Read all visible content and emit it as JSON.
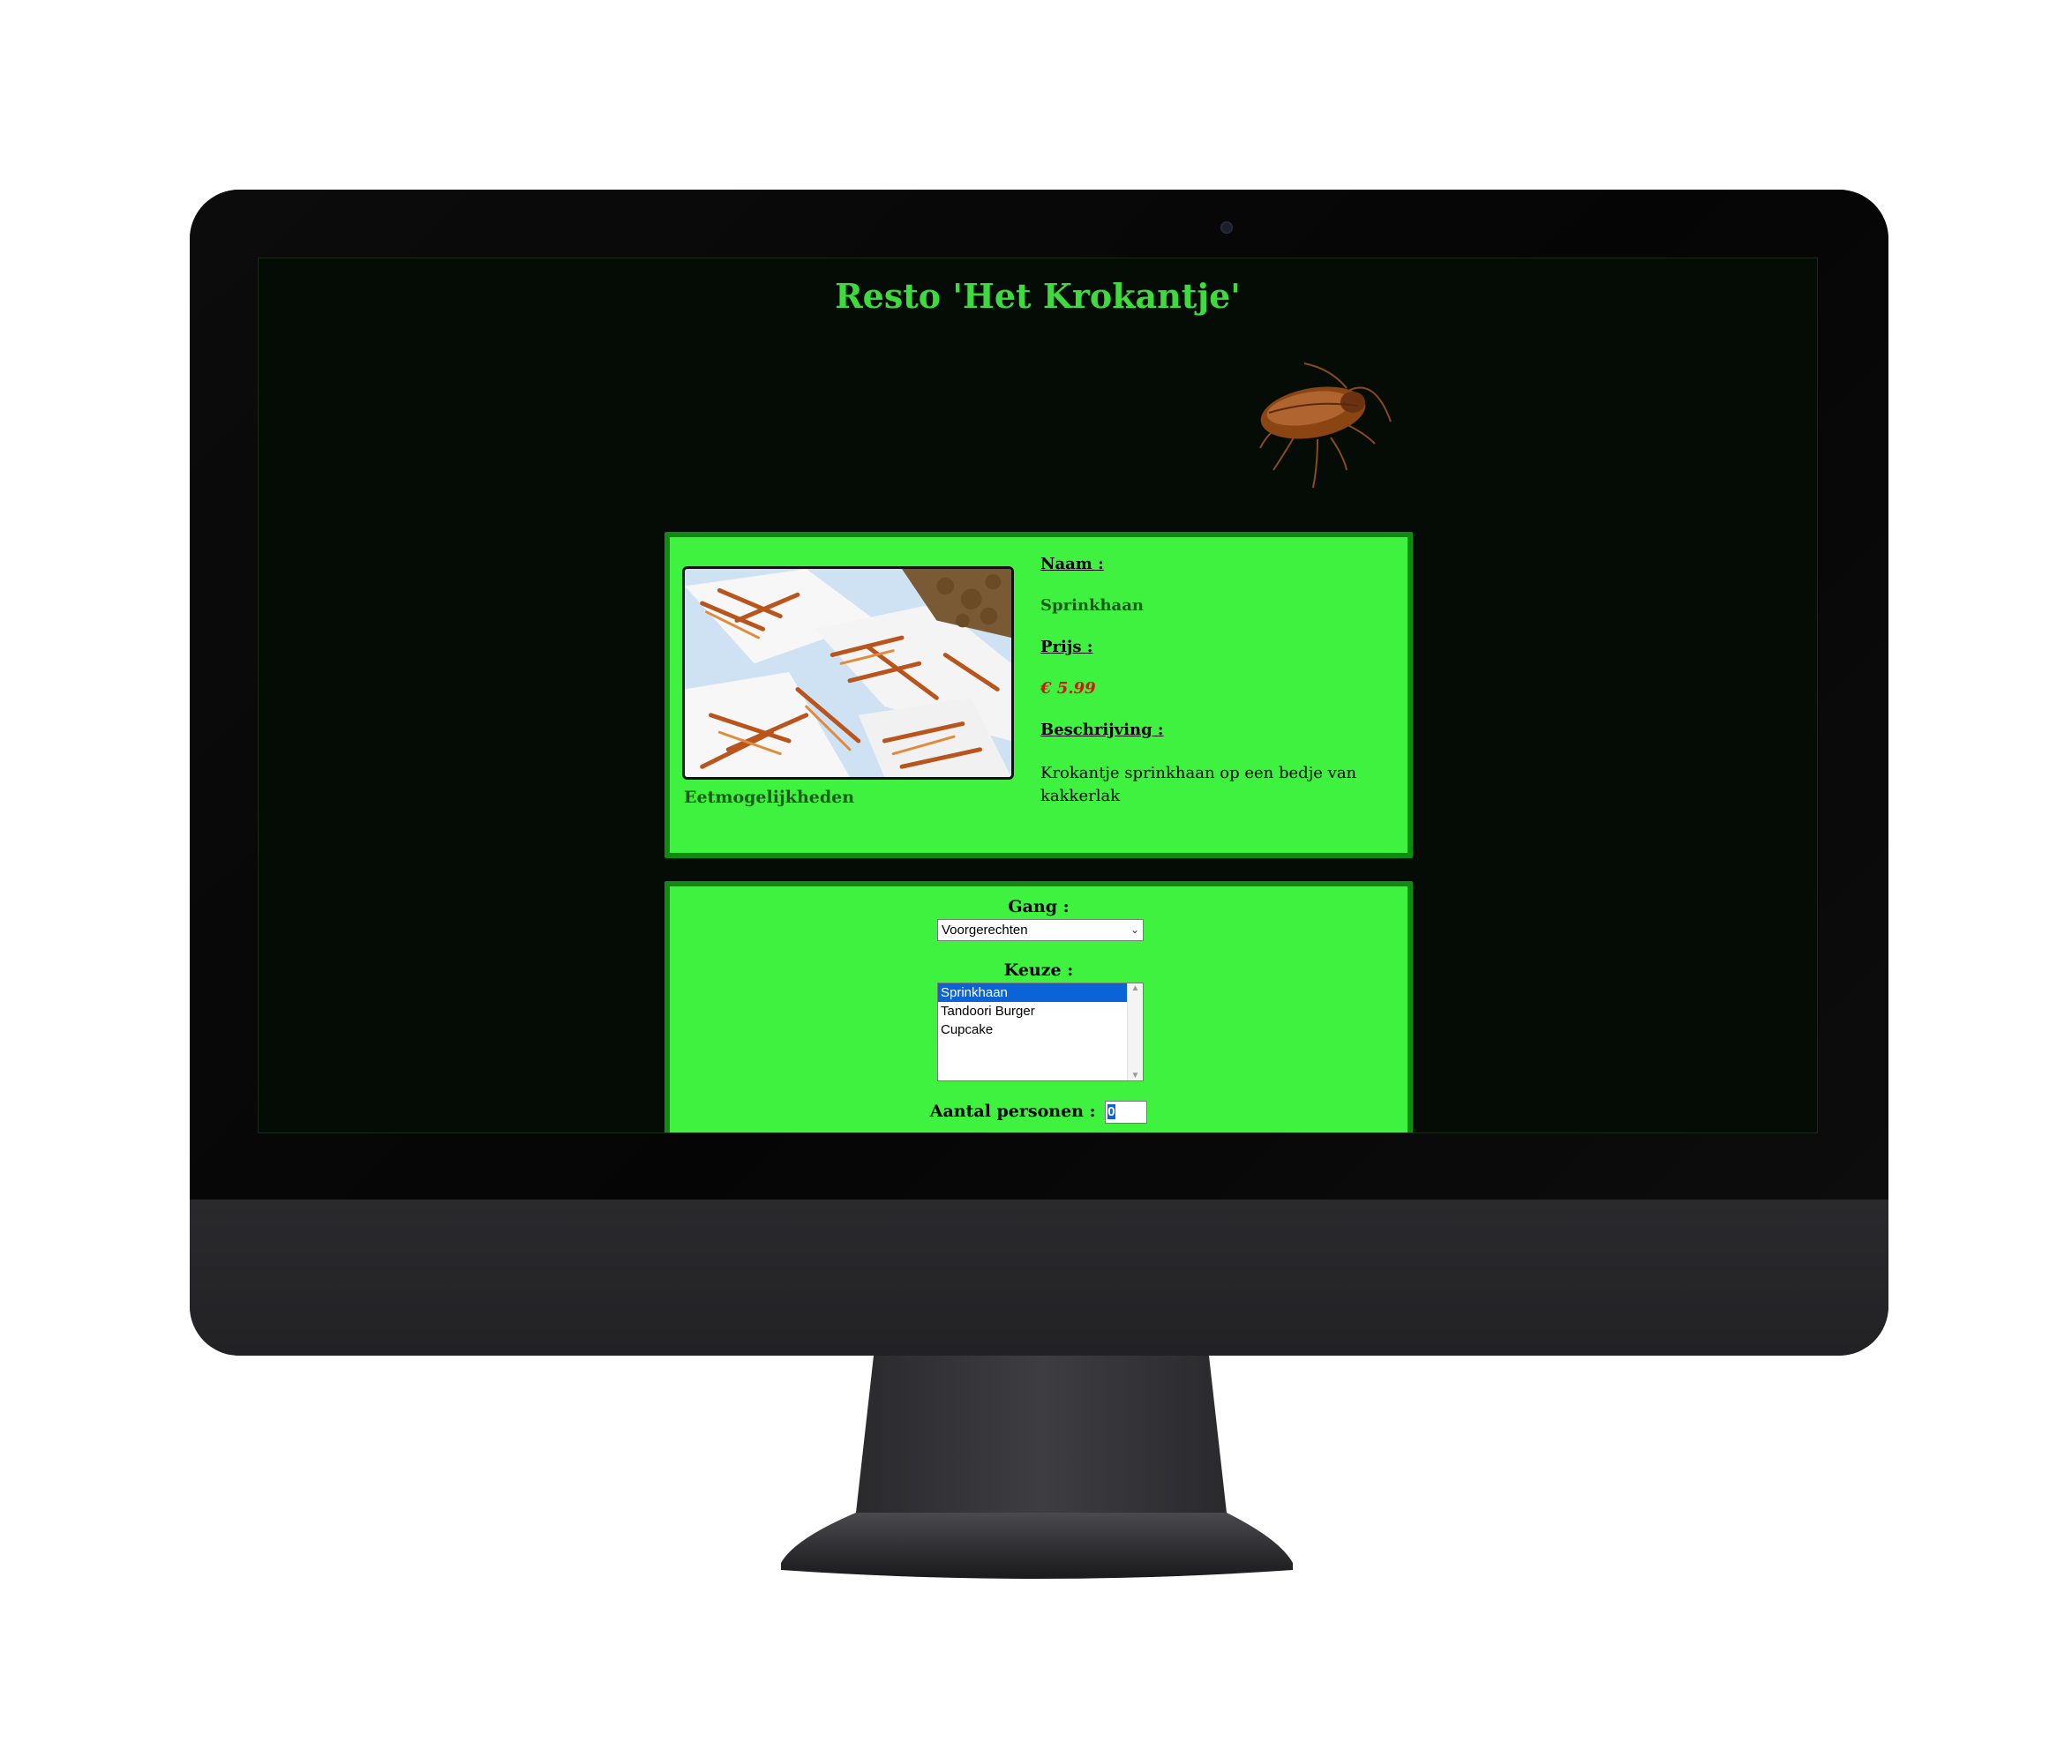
{
  "site": {
    "title": "Resto 'Het Krokantje'"
  },
  "product": {
    "caption": "Eetmogelijkheden",
    "name_label": "Naam :",
    "name_value": "Sprinkhaan",
    "price_label": "Prijs :",
    "price_value": "€ 5.99",
    "description_label": "Beschrijving :",
    "description_value": "Krokantje sprinkhaan op een bedje van kakkerlak"
  },
  "order_form": {
    "course_label": "Gang :",
    "course_selected": "Voorgerechten",
    "choice_label": "Keuze :",
    "choice_options": [
      "Sprinkhaan",
      "Tandoori Burger",
      "Cupcake"
    ],
    "choice_selected_index": 0,
    "persons_label": "Aantal personen :",
    "persons_value": "0"
  },
  "colors": {
    "page_background": "#050c05",
    "title_green": "#3ddc3d",
    "card_background": "#3ff23f",
    "card_border": "#108a10",
    "price_red": "#e01010",
    "selection_blue": "#0a64d8"
  },
  "icons": {
    "decoration": "cockroach-image",
    "device_logo": "apple-logo-icon"
  }
}
